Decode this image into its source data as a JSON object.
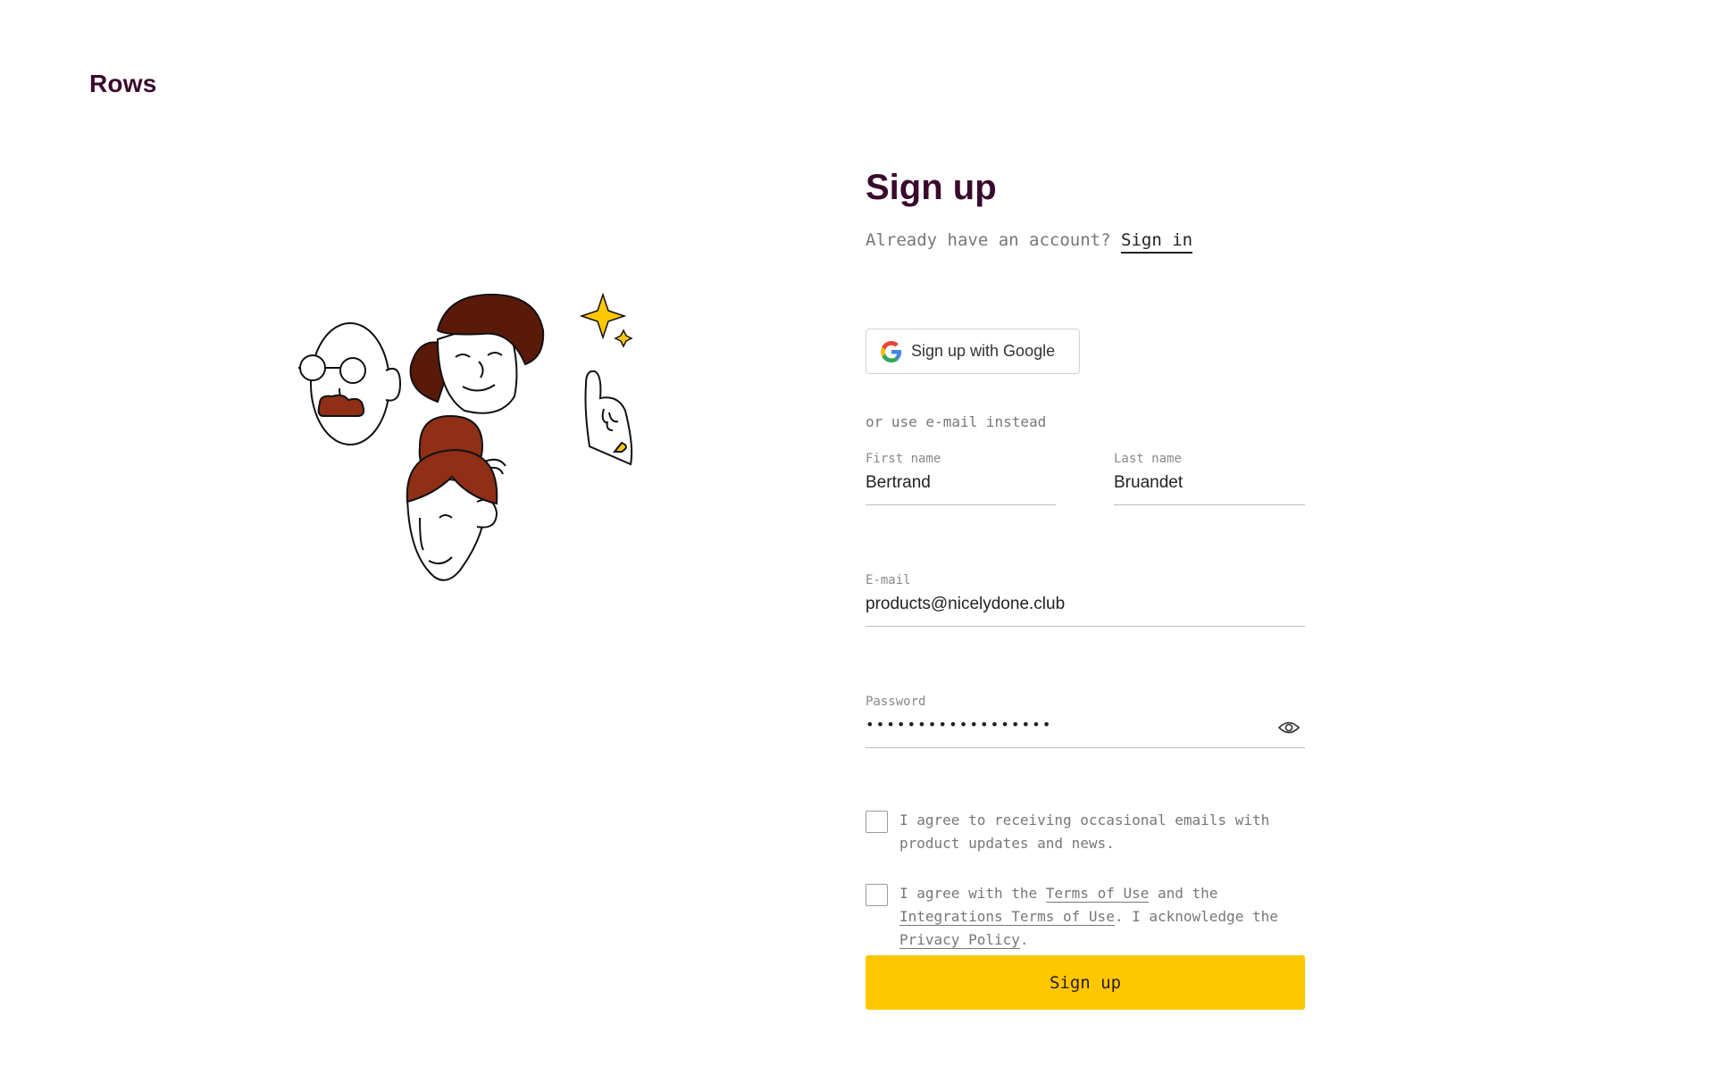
{
  "brand": {
    "logo": "Rows"
  },
  "form": {
    "title": "Sign up",
    "already_text": "Already have an account?",
    "sign_in_link": "Sign in",
    "google_button": "Sign up with Google",
    "or_text": "or use e-mail instead",
    "first_name": {
      "label": "First name",
      "value": "Bertrand"
    },
    "last_name": {
      "label": "Last name",
      "value": "Bruandet"
    },
    "email": {
      "label": "E-mail",
      "value": "products@nicelydone.club"
    },
    "password": {
      "label": "Password",
      "value": "••••••••••••••••••"
    },
    "consent_emails": "I agree to receiving occasional emails with product updates and news.",
    "terms": {
      "prefix": "I agree with the ",
      "terms_link": "Terms of Use",
      "middle": " and the ",
      "integrations_link": "Integrations Terms of Use",
      "middle2": ". I acknowledge the ",
      "privacy_link": "Privacy Policy",
      "suffix": "."
    },
    "submit_button": "Sign up"
  },
  "icons": [
    "google-icon",
    "eye-icon"
  ],
  "colors": {
    "brand": "#3a0a2e",
    "accent": "#ffc700"
  }
}
